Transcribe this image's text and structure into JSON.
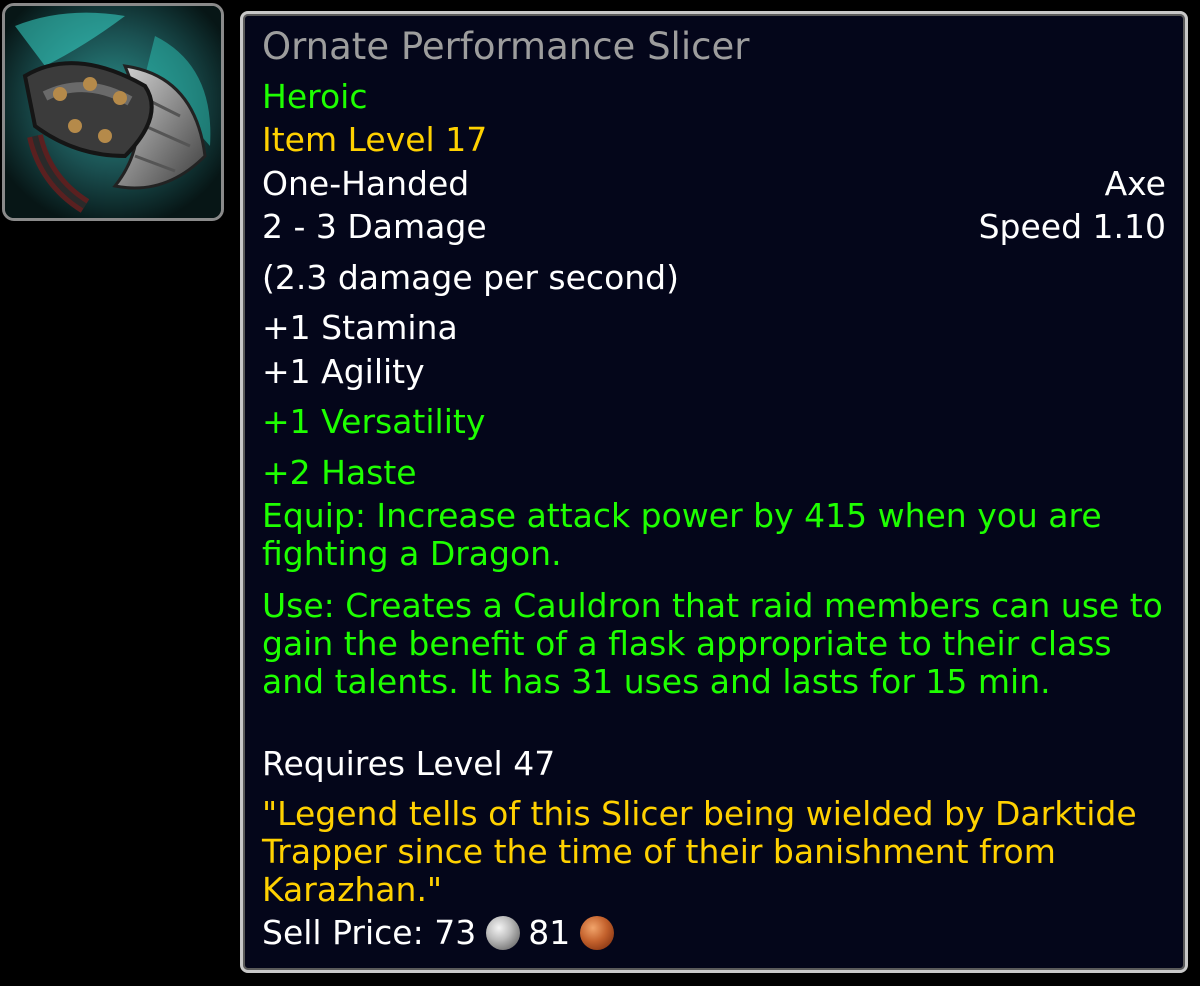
{
  "item": {
    "name": "Ornate Performance Slicer",
    "difficulty": "Heroic",
    "item_level": "Item Level 17",
    "slot": "One-Handed",
    "type": "Axe",
    "damage": "2 - 3 Damage",
    "speed": "Speed 1.10",
    "dps": "(2.3 damage per second)",
    "stats": {
      "stamina": "+1 Stamina",
      "agility": "+1 Agility",
      "versatility": "+1 Versatility",
      "haste": "+2 Haste"
    },
    "equip_effect": "Equip: Increase attack power by 415 when you are fighting a Dragon.",
    "use_effect": "Use: Creates a Cauldron that raid members can use to gain the benefit of a flask appropriate to their class and talents. It has 31 uses and lasts for 15 min.",
    "requirement": "Requires Level 47",
    "flavor_text": "\"Legend tells of this Slicer being wielded by Darktide Trapper since the time of their banishment from Karazhan.\"",
    "sell_price": {
      "label": "Sell Price:",
      "silver": "73",
      "copper": "81"
    },
    "icon": "axe-weapon-icon"
  },
  "colors": {
    "name_poor": "#9d9d9d",
    "heroic_green": "#1eff00",
    "item_level_gold": "#ffd100",
    "text_white": "#ffffff",
    "tooltip_bg": "#04061a",
    "tooltip_border": "#c8c8c8"
  }
}
